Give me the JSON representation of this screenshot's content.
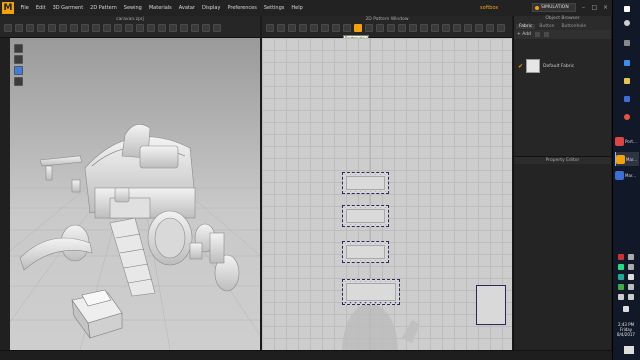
{
  "app": {
    "logo": "M",
    "menu": [
      "File",
      "Edit",
      "3D Garment",
      "2D Pattern",
      "Sewing",
      "Materials",
      "Avatar",
      "Display",
      "Preferences",
      "Settings",
      "Help"
    ],
    "user_name": "softbox",
    "simulation_label": "SIMULATION",
    "window_controls": [
      "minimize-icon",
      "maximize-icon",
      "close-icon"
    ]
  },
  "view3d": {
    "title": "caravan.zprj",
    "toolbar_icons": 20
  },
  "view2d": {
    "title": "2D Pattern Window",
    "tooltip": "Rectangle (S)",
    "toolbar_icons": 22
  },
  "object_browser": {
    "title": "Object Browser",
    "tabs": [
      "Fabric",
      "Button",
      "Buttonhole"
    ],
    "active_tab": "Fabric",
    "add_label": "+ Add",
    "fabric_item": "Default Fabric"
  },
  "property_editor": {
    "title": "Property Editor"
  },
  "taskbar": {
    "apps": [
      {
        "name": "Port...",
        "icon": "shield-app-icon"
      },
      {
        "name": "Mar...",
        "icon": "marvelous-app-icon"
      },
      {
        "name": "Mar...",
        "icon": "window-app-icon"
      }
    ],
    "clock": {
      "time": "2:43 PM",
      "day": "Friday",
      "date": "8/4/2017"
    }
  },
  "colors": {
    "accent": "#f2a20d",
    "menubar": "#222222",
    "viewport3d": "#c9c9c9",
    "pattern_window": "#cdcdcd",
    "pattern_outline": "#1d2b8f",
    "taskbar": "#111827"
  }
}
